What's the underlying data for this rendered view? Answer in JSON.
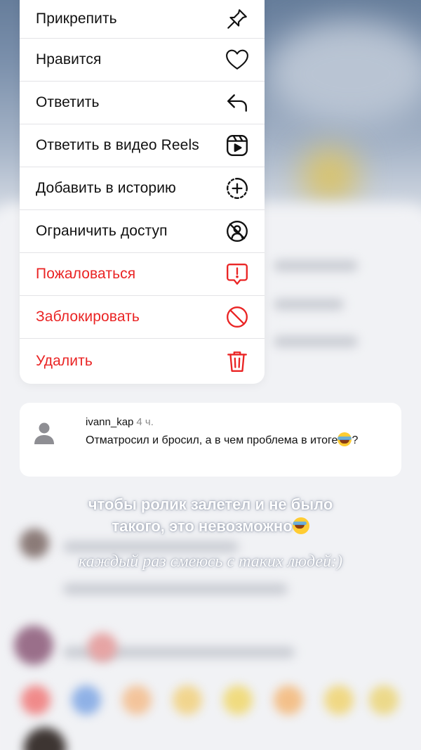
{
  "menu": {
    "items": [
      {
        "label": "Прикрепить",
        "icon": "pin-icon",
        "danger": false
      },
      {
        "label": "Нравится",
        "icon": "heart-icon",
        "danger": false
      },
      {
        "label": "Ответить",
        "icon": "reply-arrow-icon",
        "danger": false
      },
      {
        "label": "Ответить в видео Reels",
        "icon": "reels-icon",
        "danger": false
      },
      {
        "label": "Добавить в историю",
        "icon": "add-story-icon",
        "danger": false
      },
      {
        "label": "Ограничить доступ",
        "icon": "restrict-icon",
        "danger": false
      },
      {
        "label": "Пожаловаться",
        "icon": "report-icon",
        "danger": true
      },
      {
        "label": "Заблокировать",
        "icon": "block-icon",
        "danger": true
      },
      {
        "label": "Удалить",
        "icon": "trash-icon",
        "danger": true
      }
    ],
    "danger_color": "#ea2424"
  },
  "comment": {
    "username": "ivann_kap",
    "time": "4 ч.",
    "text_before": "Отматросил и бросил, а в чем проблема в итоге",
    "text_after": "?",
    "avatar_icon": "default-avatar-icon"
  },
  "captions": {
    "line1": "чтобы ролик залетел и не было",
    "line2": "такого, это невозможно",
    "line3": "каждый раз смеюсь с таких людей:)"
  }
}
